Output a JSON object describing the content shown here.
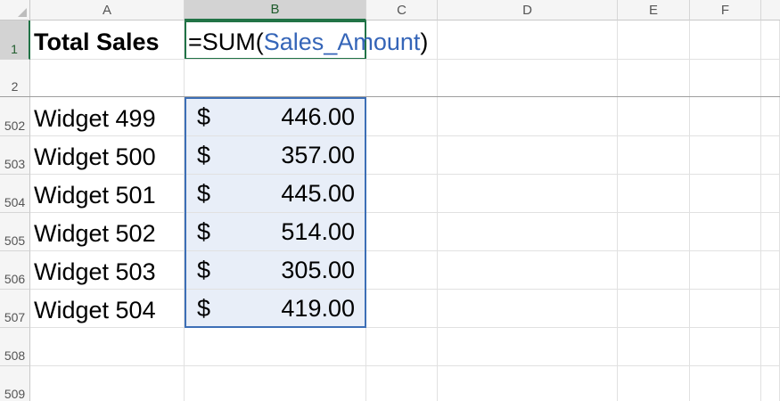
{
  "columns": [
    "A",
    "B",
    "C",
    "D",
    "E",
    "F"
  ],
  "rows": {
    "r1": "1",
    "r2": "2",
    "r502": "502",
    "r503": "503",
    "r504": "504",
    "r505": "505",
    "r506": "506",
    "r507": "507",
    "r508": "508",
    "r509": "509"
  },
  "header_cell": {
    "label": "Total Sales",
    "formula_prefix": "=SUM(",
    "formula_ref": "Sales_Amount",
    "formula_suffix": ")"
  },
  "sales_rows": [
    {
      "product": "Widget 499",
      "currency": "$",
      "amount": "446.00"
    },
    {
      "product": "Widget 500",
      "currency": "$",
      "amount": "357.00"
    },
    {
      "product": "Widget 501",
      "currency": "$",
      "amount": "445.00"
    },
    {
      "product": "Widget 502",
      "currency": "$",
      "amount": "514.00"
    },
    {
      "product": "Widget 503",
      "currency": "$",
      "amount": "305.00"
    },
    {
      "product": "Widget 504",
      "currency": "$",
      "amount": "419.00"
    }
  ],
  "colors": {
    "active_cell_border": "#217346",
    "range_ref_border": "#3d6fb6",
    "range_fill": "#e8eef8",
    "formula_ref_text": "#3565b8"
  }
}
